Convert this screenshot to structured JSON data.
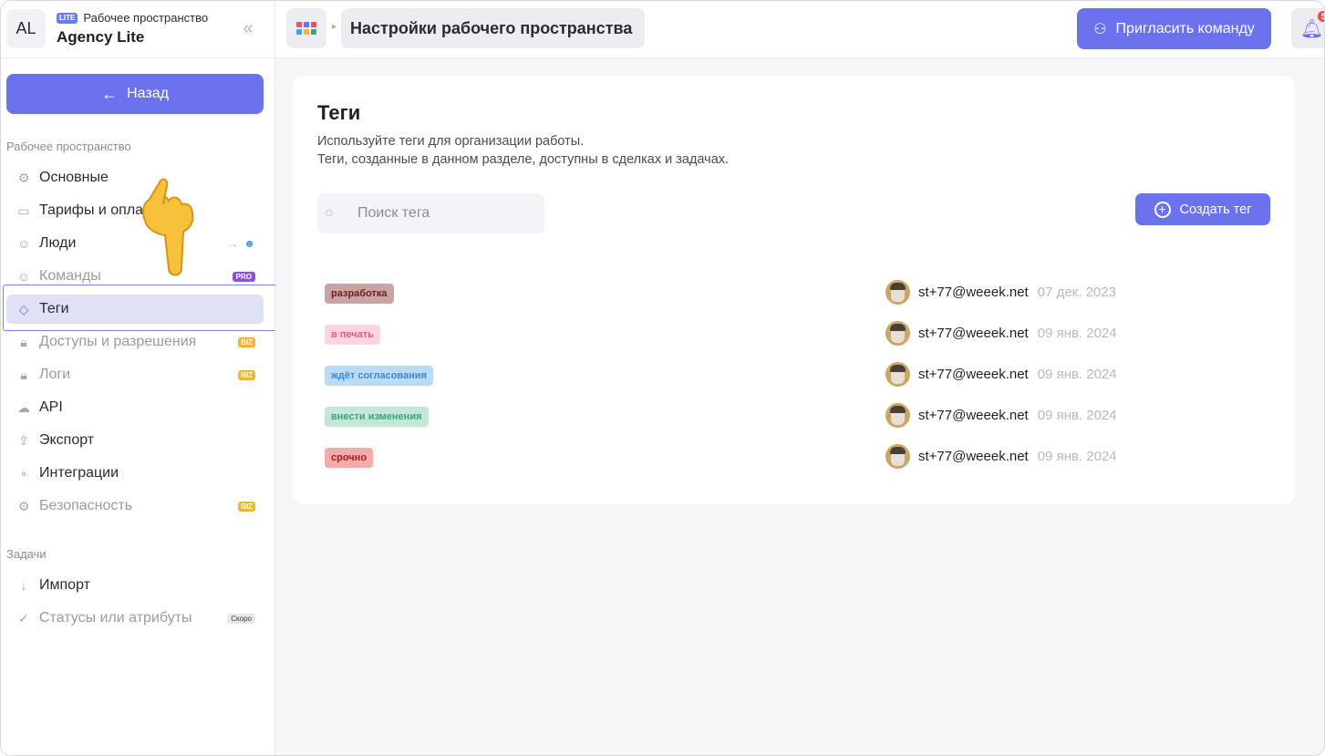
{
  "workspace": {
    "avatar_initials": "AL",
    "plan_badge": "LITE",
    "label": "Рабочее пространство",
    "name": "Agency Lite"
  },
  "sidebar": {
    "back_label": "Назад",
    "sections": [
      {
        "title": "Рабочее пространство",
        "items": [
          {
            "label": "Основные",
            "icon": "gear-icon",
            "badge": ""
          },
          {
            "label": "Тарифы и оплата",
            "icon": "card-icon",
            "badge": ""
          },
          {
            "label": "Люди",
            "icon": "people-icon",
            "badge": ""
          },
          {
            "label": "Команды",
            "icon": "team-icon",
            "badge": "PRO"
          },
          {
            "label": "Теги",
            "icon": "tag-icon",
            "badge": "",
            "active": true
          },
          {
            "label": "Доступы и разрешения",
            "icon": "lock-icon",
            "badge": "BIZ"
          },
          {
            "label": "Логи",
            "icon": "lock-icon",
            "badge": "BIZ"
          },
          {
            "label": "API",
            "icon": "cloud-icon",
            "badge": ""
          },
          {
            "label": "Экспорт",
            "icon": "export-icon",
            "badge": ""
          },
          {
            "label": "Интеграции",
            "icon": "integrations-icon",
            "badge": ""
          },
          {
            "label": "Безопасность",
            "icon": "gear-icon",
            "badge": "BIZ"
          }
        ]
      },
      {
        "title": "Задачи",
        "items": [
          {
            "label": "Импорт",
            "icon": "download-icon",
            "badge": ""
          },
          {
            "label": "Статусы или атрибуты",
            "icon": "check-circle-icon",
            "badge": "Скоро"
          }
        ]
      }
    ]
  },
  "topbar": {
    "title": "Настройки рабочего пространства",
    "invite_label": "Пригласить команду",
    "notifications_count": "5"
  },
  "tags_page": {
    "title": "Теги",
    "description_line1": "Используйте теги для организации работы.",
    "description_line2": "Теги, созданные в данном разделе, доступны в сделках и задачах.",
    "search_placeholder": "Поиск тега",
    "create_label": "Создать тег",
    "rows": [
      {
        "tag": "разработка",
        "tag_bg": "#c9a4a4",
        "tag_color": "#6b1e1e",
        "author": "st+77@weeek.net",
        "date": "07 дек. 2023"
      },
      {
        "tag": "в печать",
        "tag_bg": "#fbd5e1",
        "tag_color": "#e05c8a",
        "author": "st+77@weeek.net",
        "date": "09 янв. 2024"
      },
      {
        "tag": "ждёт согласования",
        "tag_bg": "#bcdcf6",
        "tag_color": "#3b8ad6",
        "author": "st+77@weeek.net",
        "date": "09 янв. 2024"
      },
      {
        "tag": "внести изменения",
        "tag_bg": "#c4e8d8",
        "tag_color": "#3aa57a",
        "author": "st+77@weeek.net",
        "date": "09 янв. 2024"
      },
      {
        "tag": "срочно",
        "tag_bg": "#f6aaaa",
        "tag_color": "#a61e1e",
        "author": "st+77@weeek.net",
        "date": "09 янв. 2024"
      }
    ]
  },
  "colors": {
    "accent": "#6b72ee",
    "active_nav_bg": "#dfe1f4",
    "badge_pro": "#8f4fe0",
    "badge_biz": "#f0b43c",
    "notification": "#ef4a4a"
  }
}
